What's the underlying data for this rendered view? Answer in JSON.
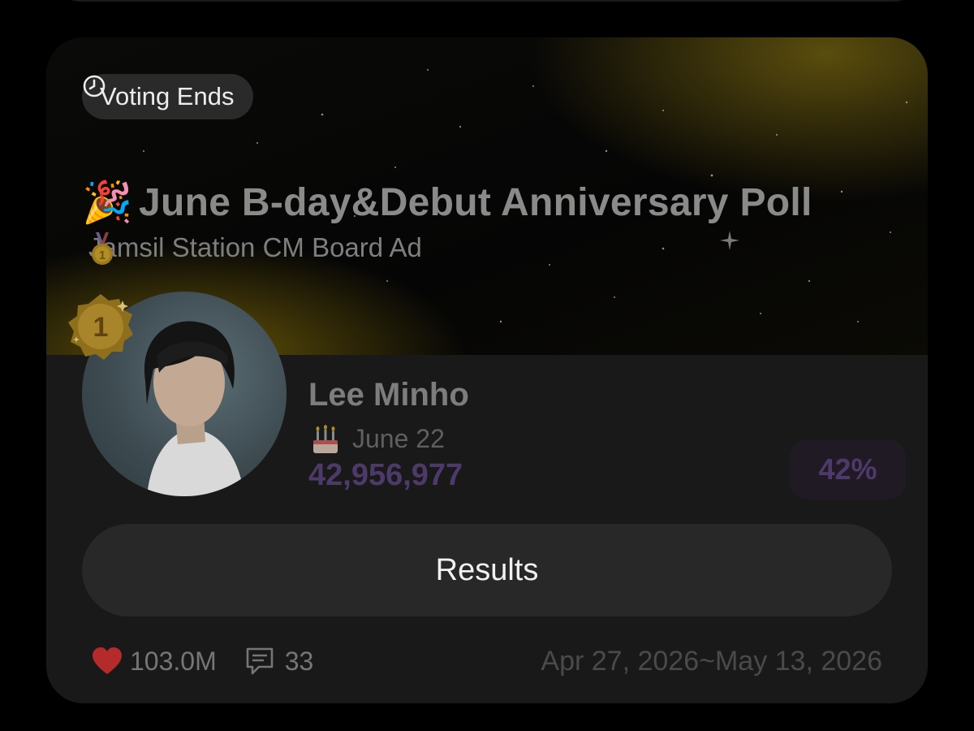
{
  "poll": {
    "status_badge": {
      "label": "Voting Ends",
      "icon": "clock-icon"
    },
    "title_emoji": "🎉",
    "title": "June B-day&Debut Anniversary Poll",
    "subtitle_icon": "medal-icon",
    "subtitle": "Jamsil Station CM Board Ad",
    "leader": {
      "rank": "1",
      "name": "Lee Minho",
      "birthday_icon": "cake-icon",
      "birthday": "June 22",
      "votes": "42,956,977",
      "percent": "42%"
    },
    "results_button": "Results",
    "footer": {
      "likes": "103.0M",
      "comments": "33",
      "date_range": "Apr 27, 2026~May 13, 2026"
    }
  },
  "colors": {
    "background": "#000000",
    "card": "#191919",
    "gold_glow": "#a08714",
    "votes_purple": "#4d3a6a",
    "heart_red": "#b52a2a"
  }
}
